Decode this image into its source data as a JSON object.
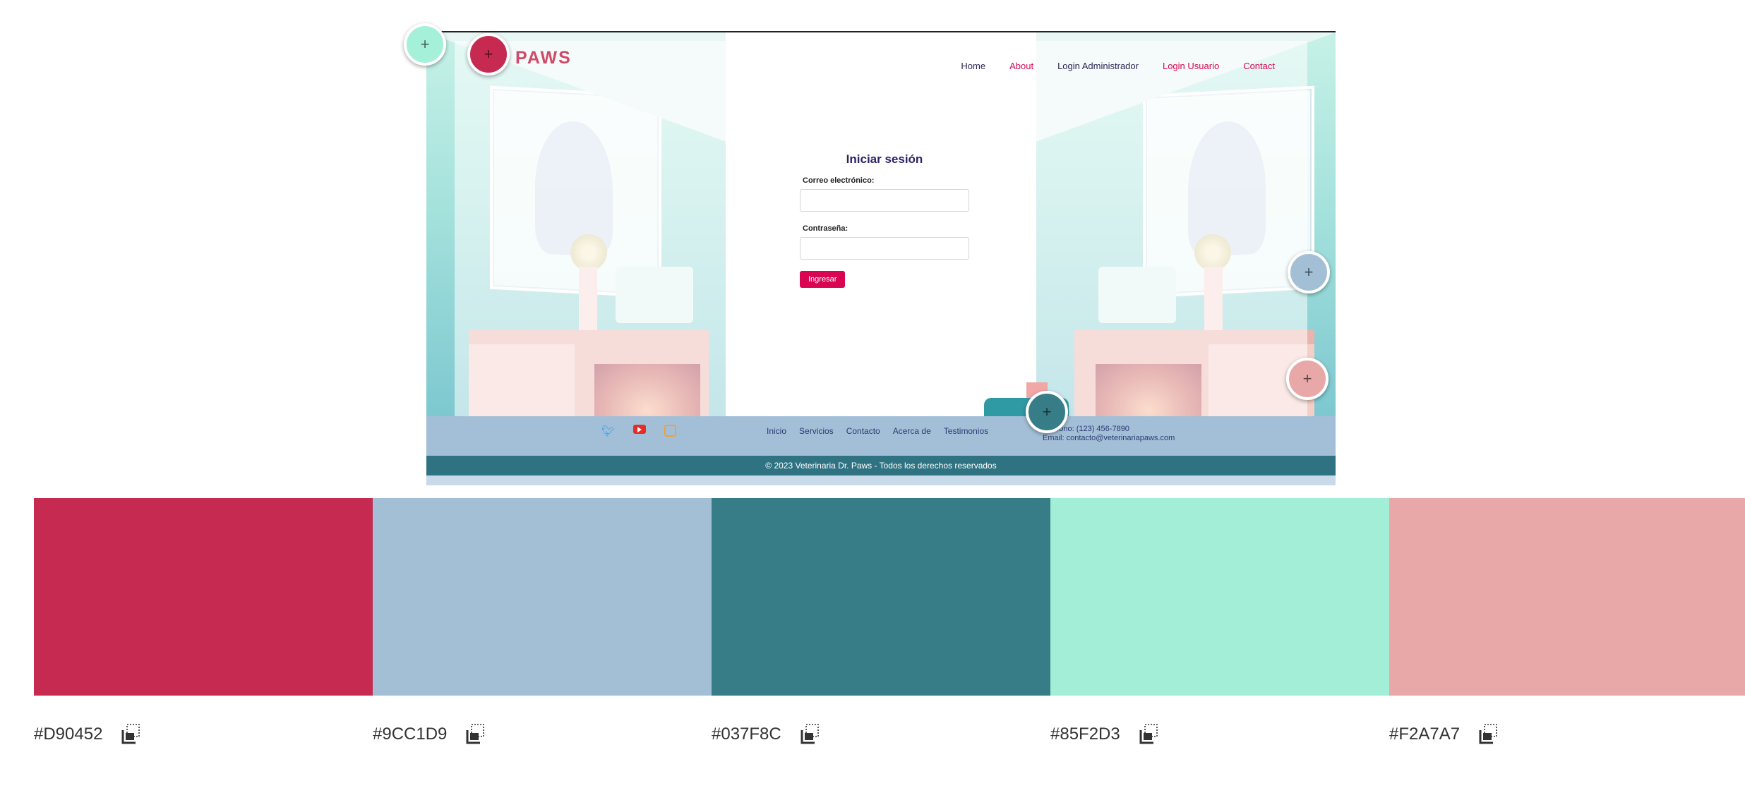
{
  "preview": {
    "logo": "PAWS",
    "nav": [
      "Home",
      "About",
      "Login Administrador",
      "Login Usuario",
      "Contact"
    ],
    "login": {
      "title": "Iniciar sesión",
      "email_label": "Correo electrónico:",
      "password_label": "Contraseña:",
      "submit_label": "Ingresar"
    },
    "footer": {
      "social_icons": [
        "twitter-icon",
        "youtube-icon",
        "instagram-icon"
      ],
      "links": [
        "Inicio",
        "Servicios",
        "Contacto",
        "Acerca de",
        "Testimonios"
      ],
      "contact_phone": "Teléfono: (123) 456-7890",
      "contact_email": "Email: contacto@veterinariapaws.com",
      "copyright": "© 2023 Veterinaria Dr. Paws - Todos los derechos reservados"
    }
  },
  "pickers": [
    {
      "icon": "plus-icon",
      "color": "#85F2D3"
    },
    {
      "icon": "plus-icon",
      "color": "#D90452"
    },
    {
      "icon": "plus-icon",
      "color": "#9CC1D9"
    },
    {
      "icon": "plus-icon",
      "color": "#F2A7A7"
    },
    {
      "icon": "plus-icon",
      "color": "#037F8C"
    }
  ],
  "palette": [
    {
      "hex": "#D90452",
      "swatch": "#C62A50"
    },
    {
      "hex": "#9CC1D9",
      "swatch": "#A3BFD6"
    },
    {
      "hex": "#037F8C",
      "swatch": "#377D88"
    },
    {
      "hex": "#85F2D3",
      "swatch": "#A2EED6"
    },
    {
      "hex": "#F2A7A7",
      "swatch": "#E8A8A7"
    }
  ],
  "copy_icon": "copy-icon"
}
